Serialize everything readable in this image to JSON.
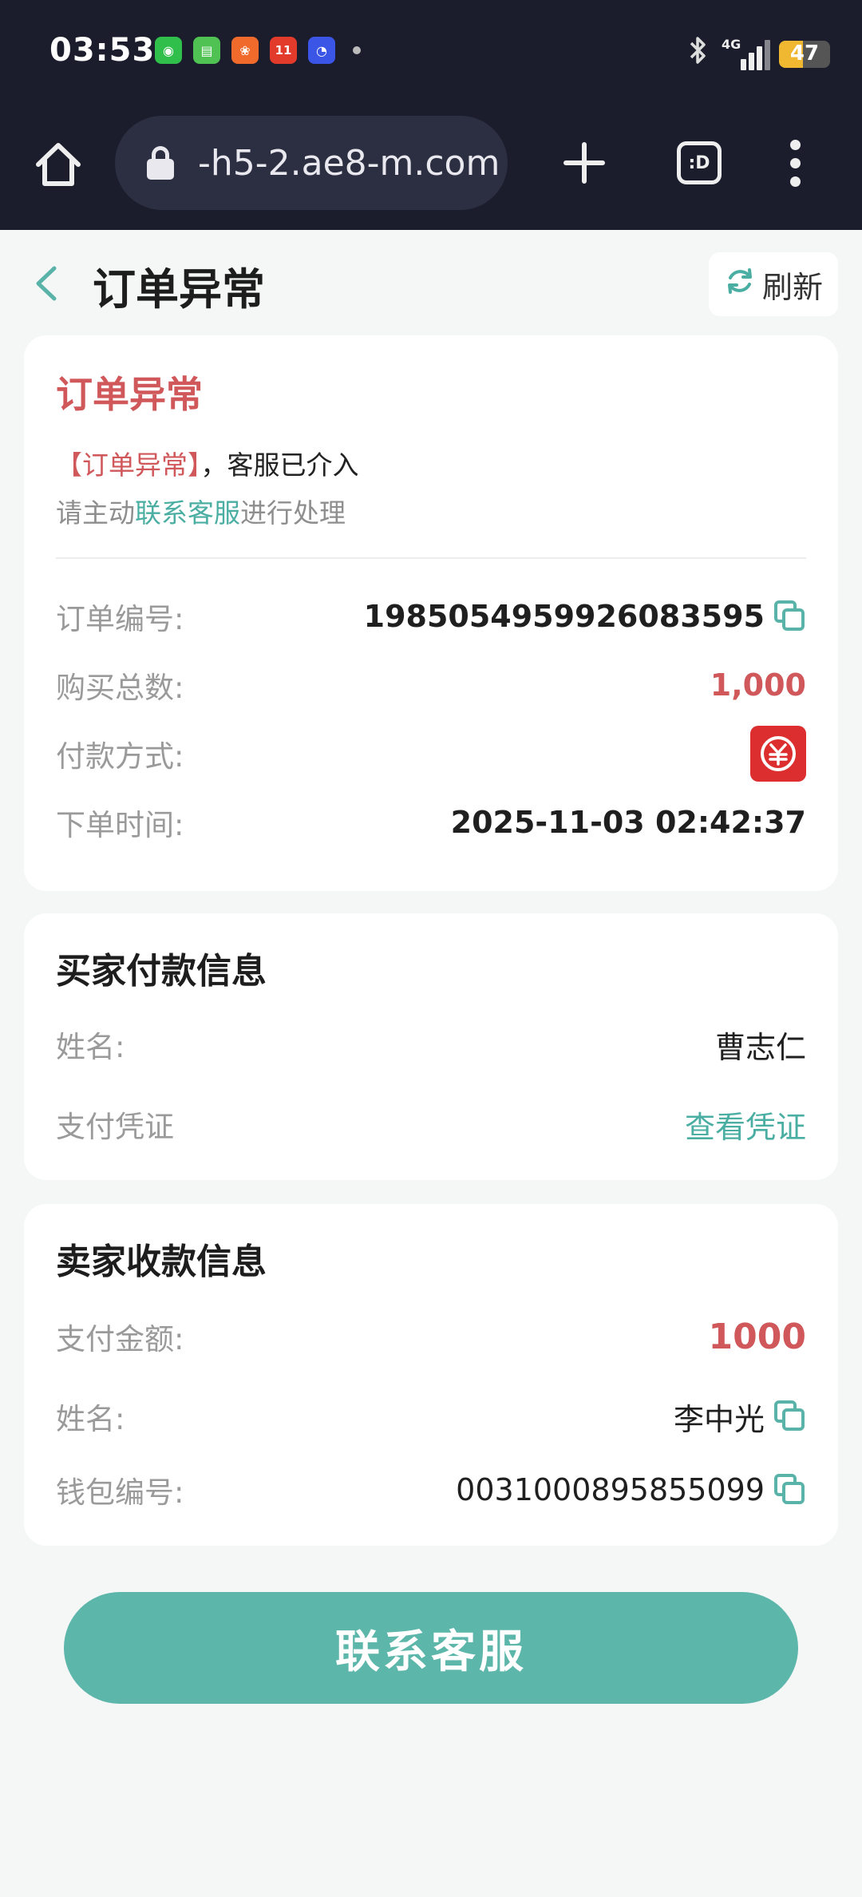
{
  "status_bar": {
    "time": "03:53",
    "apps": [
      {
        "icon": "wechat-icon",
        "color": "#2fbf4a",
        "glyph": "◉"
      },
      {
        "icon": "messages-icon",
        "color": "#4fc253",
        "glyph": "▤"
      },
      {
        "icon": "app-orange-icon",
        "color": "#f06a2c",
        "glyph": "❀"
      },
      {
        "icon": "double11-icon",
        "color": "#e23b2b",
        "glyph": "11"
      },
      {
        "icon": "qq-icon",
        "color": "#3b55e6",
        "glyph": "◔"
      }
    ],
    "network": "4G",
    "battery": "47"
  },
  "browser": {
    "url": "-h5-2.ae8-m.com",
    "tabs_label": ":D"
  },
  "header": {
    "title": "订单异常",
    "refresh_label": "刷新"
  },
  "order": {
    "status_title": "订单异常",
    "status_highlight": "【订单异常】",
    "status_text": "，客服已介入",
    "hint_prefix": "请主动",
    "hint_link": "联系客服",
    "hint_suffix": "进行处理",
    "rows": {
      "order_no_label": "订单编号:",
      "order_no": "1985054959926083595",
      "total_label": "购买总数:",
      "total": "1,000",
      "pay_method_label": "付款方式:",
      "time_label": "下单时间:",
      "time": "2025-11-03 02:42:37"
    }
  },
  "buyer": {
    "title": "买家付款信息",
    "name_label": "姓名:",
    "name": "曹志仁",
    "proof_label": "支付凭证",
    "proof_link": "查看凭证"
  },
  "seller": {
    "title": "卖家收款信息",
    "amount_label": "支付金额:",
    "amount": "1000",
    "name_label": "姓名:",
    "name": "李中光",
    "wallet_label": "钱包编号:",
    "wallet": "0031000895855099"
  },
  "contact_button": "联系客服",
  "colors": {
    "accent": "#5cb6aa",
    "danger": "#d0575a",
    "topbar": "#1b1d2c"
  }
}
